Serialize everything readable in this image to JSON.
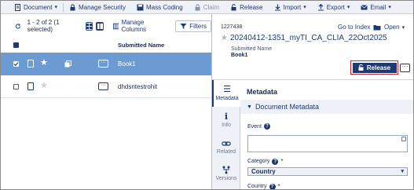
{
  "toolbar": {
    "document_label": "Document",
    "manage_security_label": "Manage Security",
    "mass_coding_label": "Mass Coding",
    "claim_label": "Claim",
    "release_label": "Release",
    "import_label": "Import",
    "export_label": "Export",
    "email_label": "Email"
  },
  "list": {
    "count_text": "1 - 2 of 2 (1 selected)",
    "manage_columns_label": "Manage Columns",
    "filters_label": "Filters",
    "column_header": "Submitted Name",
    "rows": [
      {
        "name": "Book1",
        "selected": true
      },
      {
        "name": "dhdsntestrohit",
        "selected": false
      }
    ]
  },
  "detail": {
    "doc_id": "1227438",
    "go_to_index_label": "Go to Index",
    "open_label": "Open",
    "title": "20240412-1351_myTI_CA_CLIA_22Oct2025",
    "submitted_name_label": "Submitted Name",
    "submitted_name_value": "Book1",
    "release_button_label": "Release",
    "tabs": [
      {
        "label": "Metadata",
        "icon": "list-icon"
      },
      {
        "label": "Info",
        "icon": "info-icon"
      },
      {
        "label": "Related",
        "icon": "link-icon"
      },
      {
        "label": "Versions",
        "icon": "versions-icon"
      }
    ],
    "panel_title": "Metadata",
    "section_title": "Document Metadata",
    "fields": {
      "event_label": "Event",
      "category_label": "Category",
      "category_value": "Country",
      "country_label": "Country"
    }
  },
  "colors": {
    "accent": "#1f3a73",
    "selected_row": "#6c9bd3",
    "highlight_border": "#c0282d",
    "toolbar_bg": "#eef2f8"
  }
}
